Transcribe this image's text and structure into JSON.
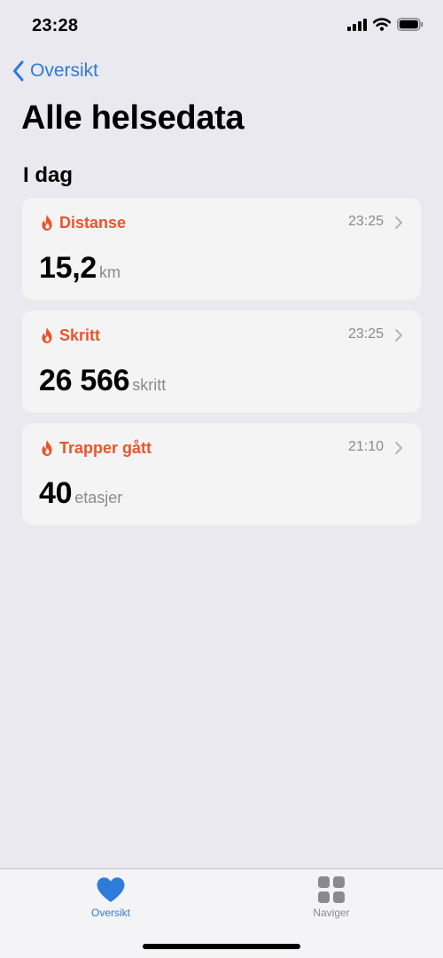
{
  "status_bar": {
    "time": "23:28"
  },
  "nav": {
    "back_label": "Oversikt"
  },
  "page": {
    "title": "Alle helsedata",
    "section": "I dag"
  },
  "cards": [
    {
      "label": "Distanse",
      "time": "23:25",
      "value": "15,2",
      "unit": "km"
    },
    {
      "label": "Skritt",
      "time": "23:25",
      "value": "26 566",
      "unit": "skritt"
    },
    {
      "label": "Trapper gått",
      "time": "21:10",
      "value": "40",
      "unit": "etasjer"
    }
  ],
  "tab_bar": {
    "tabs": [
      {
        "label": "Oversikt",
        "icon": "heart-icon",
        "active": true
      },
      {
        "label": "Naviger",
        "icon": "grid-icon",
        "active": false
      }
    ]
  },
  "colors": {
    "accent": "#2f7bd9",
    "activity": "#e8552d",
    "background": "#eae9ef",
    "card": "#f4f4f5",
    "secondary_text": "#8a8a8e"
  }
}
